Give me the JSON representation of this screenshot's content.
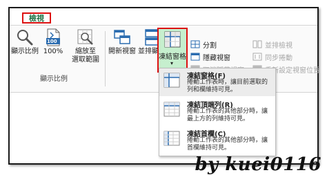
{
  "tabs": {
    "active": "檢視"
  },
  "zoom_group": {
    "label": "顯示比例",
    "zoom_button": "顯示比例",
    "hundred_button": "100%",
    "hundred_badge": "100",
    "zoom_to_selection_line1": "縮放至",
    "zoom_to_selection_line2": "選取範圍"
  },
  "window_group": {
    "new_window": "開新視窗",
    "arrange_all": "並排顯示",
    "freeze_panes": "凍結窗格",
    "split": "分割",
    "hide": "隱藏視窗",
    "unhide": "取消隱藏視窗",
    "view_side_by_side": "並排檢視",
    "sync_scroll": "同步捲動",
    "reset_position": "重新設定視窗位置"
  },
  "freeze_menu": {
    "items": [
      {
        "title": "凍結窗格(F)",
        "desc": "捲動工作表時，讓目前選取的列和欄維持可見。"
      },
      {
        "title": "凍結頂端列(R)",
        "desc": "捲動工作表的其他部分時，讓最上方的列維持可見。"
      },
      {
        "title": "凍結首欄(C)",
        "desc": "捲動工作表的其他部分時，讓首欄維持可見。"
      }
    ]
  },
  "watermark": "by kuei0116",
  "colors": {
    "accent": "#217346",
    "highlight": "#c6efce",
    "annotation": "#dd1111"
  }
}
